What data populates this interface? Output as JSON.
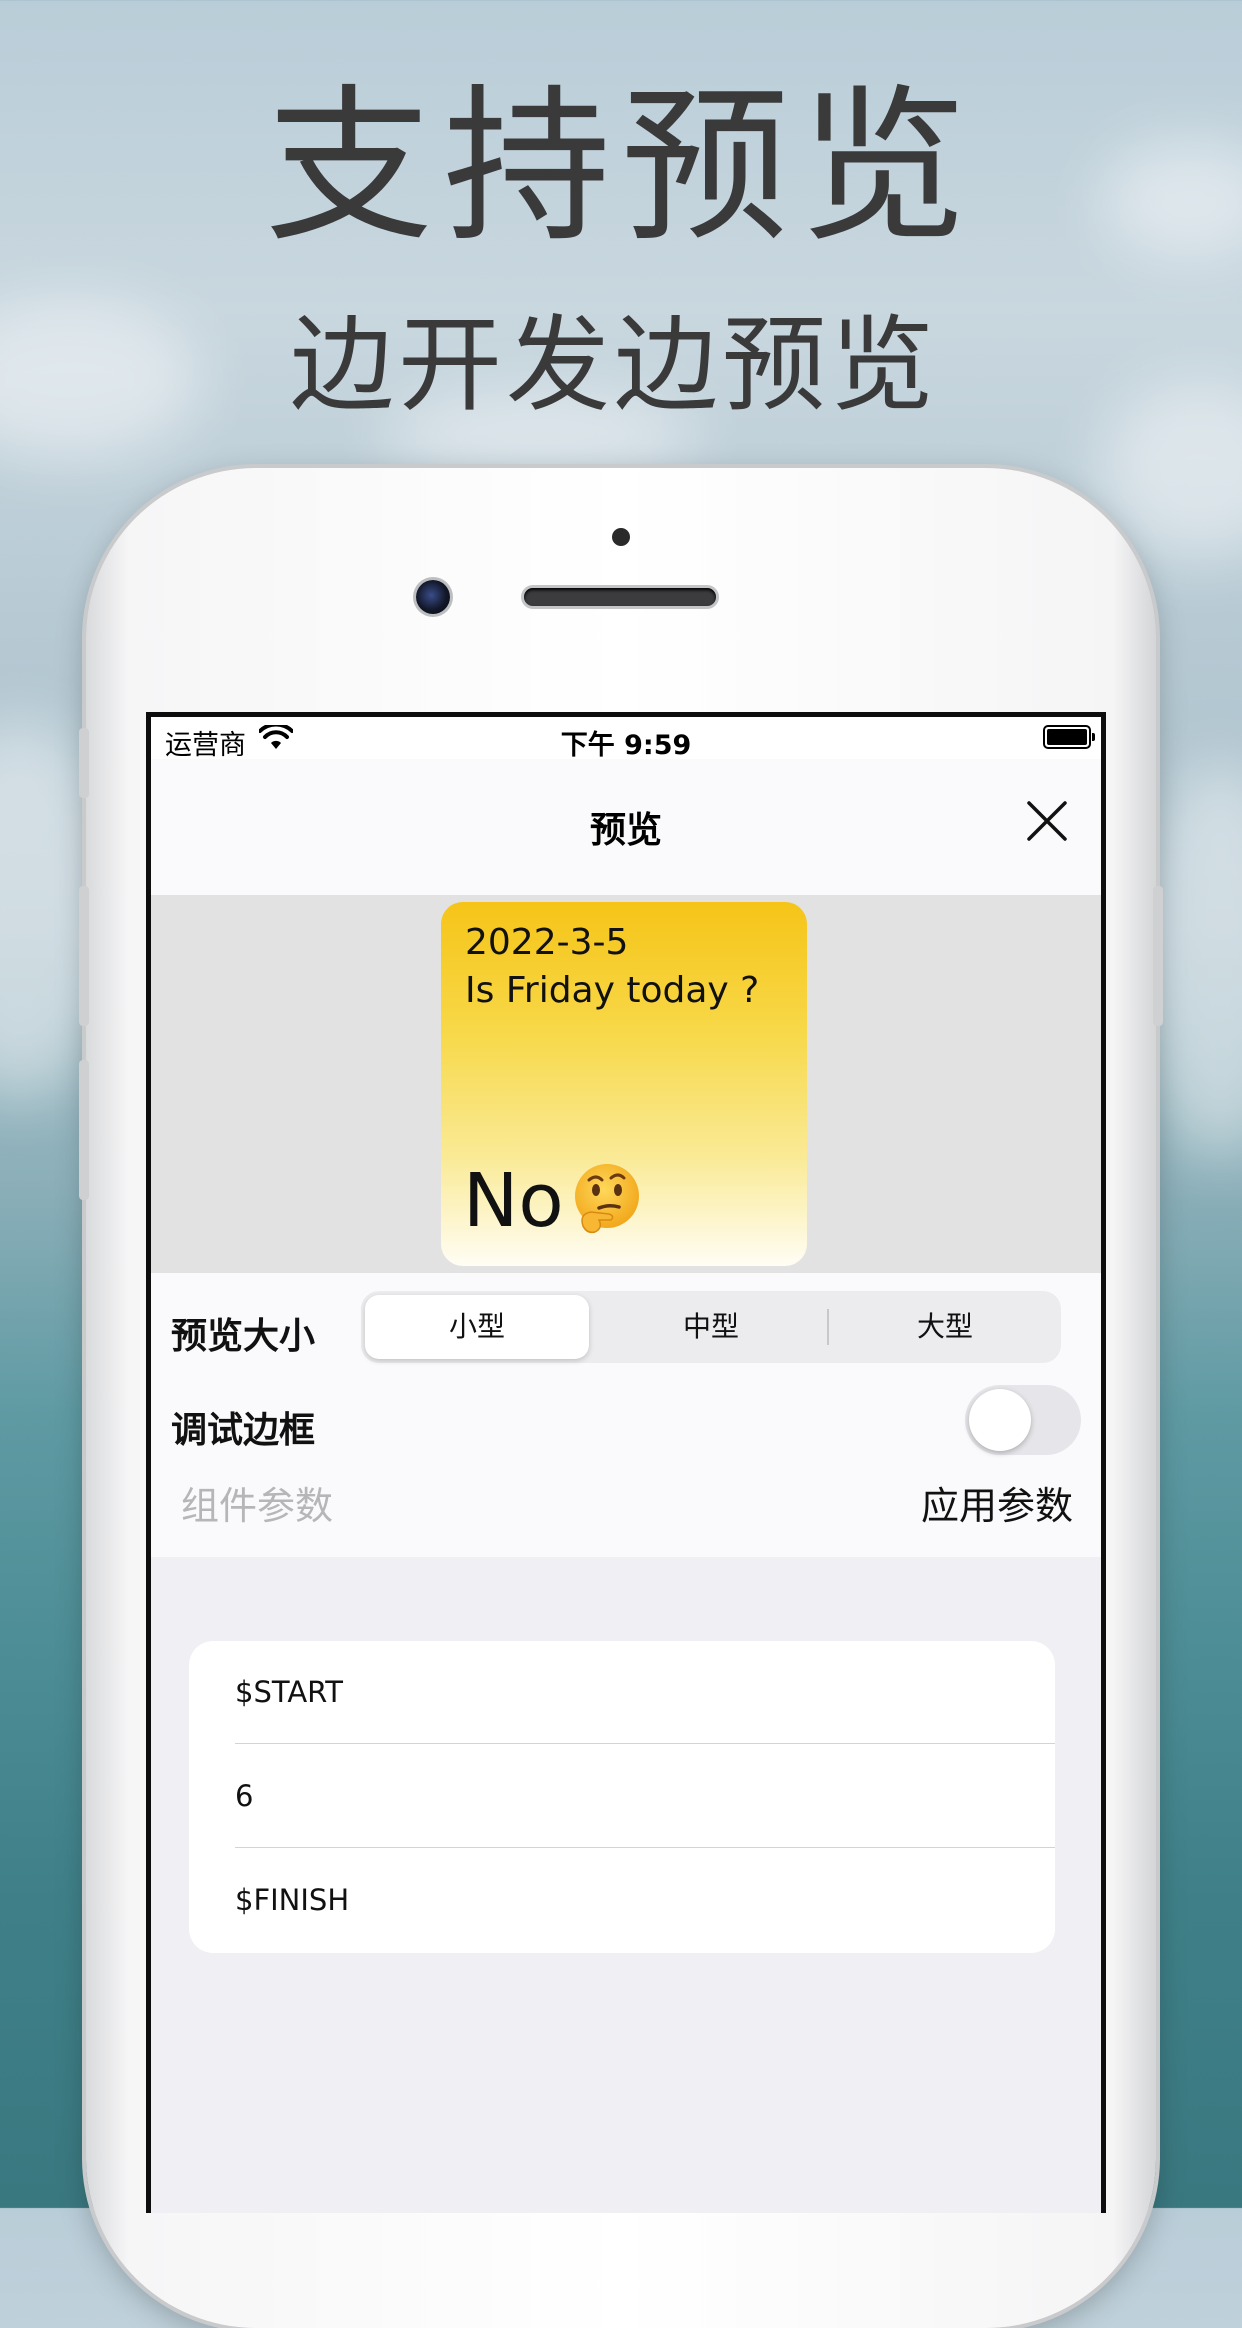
{
  "promo": {
    "headline": "支持预览",
    "subline": "边开发边预览"
  },
  "status_bar": {
    "carrier": "运营商",
    "time": "下午 9:59"
  },
  "nav": {
    "title": "预览",
    "close_icon": "close-icon"
  },
  "widget": {
    "date": "2022-3-5",
    "question": "Is Friday today ?",
    "answer": "No",
    "emoji": "thinking-face-emoji",
    "gradient_top": "#f6c418",
    "gradient_bottom": "#fffdf5"
  },
  "options": {
    "size_label": "预览大小",
    "sizes": [
      "小型",
      "中型",
      "大型"
    ],
    "selected_size": "小型",
    "debug_border_label": "调试边框",
    "debug_border_on": false,
    "params_label": "组件参数",
    "apply_label": "应用参数"
  },
  "params": [
    "$START",
    "6",
    "$FINISH"
  ]
}
